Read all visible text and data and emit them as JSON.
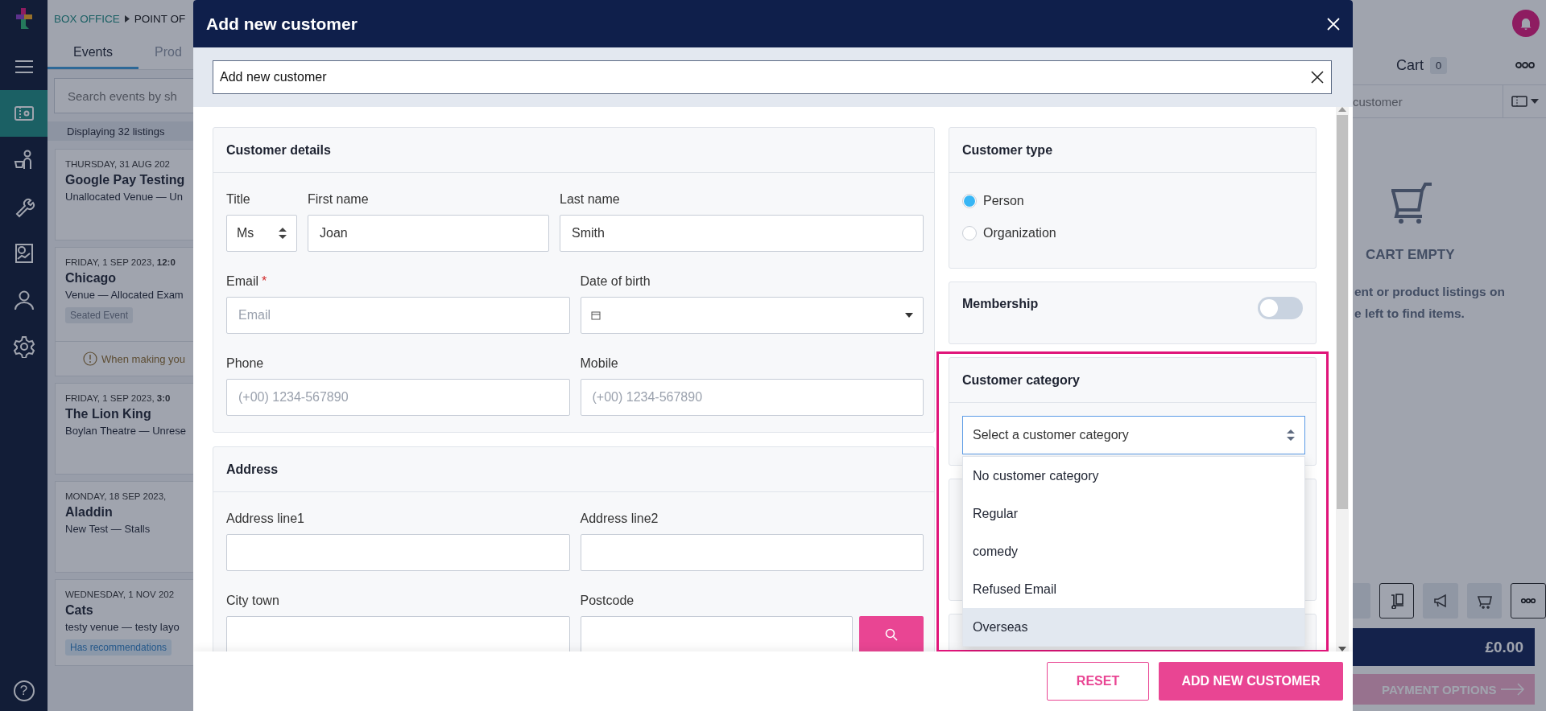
{
  "nav": {
    "help": "?",
    "items": [
      {
        "selected": true
      },
      {
        "selected": false
      },
      {
        "selected": false
      },
      {
        "selected": false
      },
      {
        "selected": false
      },
      {
        "selected": false
      }
    ]
  },
  "breadcrumb": [
    "BOX OFFICE",
    "POINT OF"
  ],
  "tabs": [
    {
      "label": "Events",
      "selected": true
    },
    {
      "label": "Prod",
      "selected": false
    }
  ],
  "event_search": {
    "placeholder": "Search events by sh"
  },
  "listing_count": "Displaying 32 listings",
  "events": [
    {
      "date": "THURSDAY, 31 AUG 202",
      "title": "Google Pay Testing",
      "venue": "Unallocated Venue — Un"
    },
    {
      "date": "FRIDAY, 1 SEP 2023, **12:0**",
      "title": "Chicago",
      "venue": "Venue — Allocated Exam",
      "tag": {
        "kind": "plain",
        "label": "Seated Event"
      },
      "notice": "When making you"
    },
    {
      "date": "FRIDAY, 1 SEP 2023, **3:0**",
      "title": "The Lion King",
      "venue": "Boylan Theatre — Unrese"
    },
    {
      "date": "MONDAY, 18 SEP 2023,",
      "title": "Aladdin",
      "venue": "New Test — Stalls"
    },
    {
      "date": "WEDNESDAY, 1 NOV 202",
      "title": "Cats",
      "venue": "testy venue — testy layo",
      "tag": {
        "kind": "recommendation",
        "label": "Has recommendations"
      }
    }
  ],
  "cart": {
    "title": "Cart",
    "count": "0",
    "customer_placeholder": "customer",
    "empty_title": "CART EMPTY",
    "empty_lines": [
      "ent or product listings on",
      "e left to find items."
    ],
    "total": "£0.00",
    "payment": {
      "label": "PAYMENT OPTIONS",
      "disabled": true
    },
    "tools": [
      {
        "selected": false
      },
      {
        "selected": true
      },
      {
        "selected": false
      },
      {
        "selected": false
      },
      {
        "selected": true
      }
    ]
  },
  "modal": {
    "title": "Add new customer",
    "search": {
      "value": "Add new customer"
    },
    "customer_details": {
      "title": "Customer details",
      "rows": [
        [
          {
            "kind": "select",
            "label": "Title",
            "value": "Ms"
          },
          {
            "kind": "text",
            "label": "First name",
            "value": "Joan"
          },
          {
            "kind": "text",
            "label": "Last name",
            "value": "Smith"
          }
        ],
        [
          {
            "kind": "text",
            "label": "Email",
            "required_mark": "*",
            "placeholder": "Email"
          },
          {
            "kind": "date",
            "label": "Date of birth"
          }
        ],
        [
          {
            "kind": "text",
            "label": "Phone",
            "placeholder": "(+00) 1234-567890"
          },
          {
            "kind": "text",
            "label": "Mobile",
            "placeholder": "(+00) 1234-567890"
          }
        ]
      ]
    },
    "address": {
      "title": "Address",
      "rows": [
        [
          {
            "kind": "text",
            "label": "Address line1"
          },
          {
            "kind": "text",
            "label": "Address line2"
          }
        ],
        [
          {
            "kind": "text",
            "label": "City town"
          },
          {
            "kind": "postcode",
            "label": "Postcode"
          }
        ]
      ]
    },
    "customer_type": {
      "title": "Customer type",
      "options": [
        {
          "label": "Person",
          "selected": true
        },
        {
          "label": "Organization",
          "selected": false
        }
      ]
    },
    "membership": {
      "title": "Membership",
      "on": false
    },
    "customer_category": {
      "title": "Customer category",
      "placeholder": "Select a customer category",
      "expanded": true,
      "highlighted": true,
      "options": [
        {
          "label": "No customer category",
          "selected": false
        },
        {
          "label": "Regular",
          "selected": false
        },
        {
          "label": "comedy",
          "selected": false
        },
        {
          "label": "Refused Email",
          "selected": false
        },
        {
          "label": "Overseas",
          "selected": true
        }
      ]
    },
    "buttons": [
      {
        "kind": "secondary",
        "label": "RESET"
      },
      {
        "kind": "primary",
        "label": "ADD NEW CUSTOMER"
      }
    ]
  }
}
